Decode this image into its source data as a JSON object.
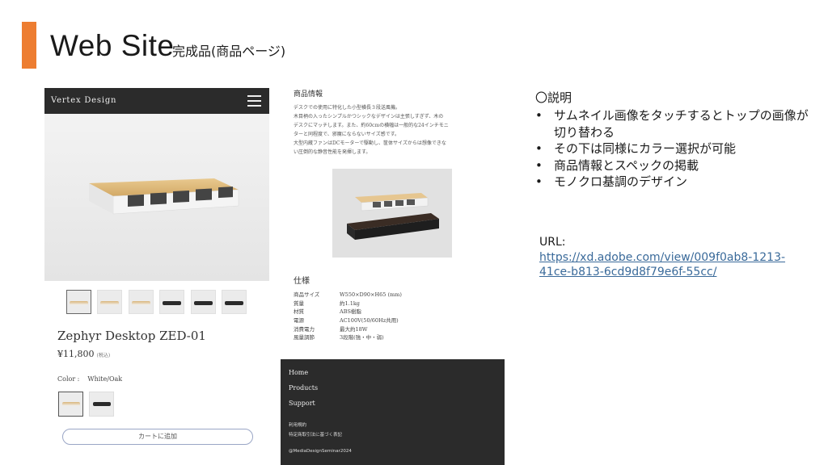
{
  "slide": {
    "title": "Web Site",
    "subtitle": "完成品(商品ページ)",
    "accent_color": "#ED7D31"
  },
  "mobile": {
    "brand": "Vertex Design",
    "menu_icon": "hamburger-menu-icon",
    "product_name": "Zephyr Desktop ZED-01",
    "price": "¥11,800",
    "tax_note": "(税込)",
    "color_label": "Color :",
    "color_value": "White/Oak",
    "cart_button": "カートに追加",
    "thumbnails": [
      {
        "variant": "white-oak",
        "selected": true
      },
      {
        "variant": "white-oak"
      },
      {
        "variant": "white-oak"
      },
      {
        "variant": "black"
      },
      {
        "variant": "black"
      },
      {
        "variant": "black"
      }
    ],
    "swatches": [
      {
        "variant": "white-oak",
        "selected": true
      },
      {
        "variant": "black"
      }
    ]
  },
  "info_page": {
    "heading": "商品情報",
    "description": [
      "デスクでの使用に特化した小型横長３段送風機。",
      "木目柄の入ったシンプルかつシックなデザインは主張しすぎず、木の",
      "デスクにマッチします。また、約60cmの横幅は一般的な24インチモニ",
      "ターと同程度で、邪魔にならないサイズ感です。",
      "大型内蔵ファンはDCモーターで駆動し、筐体サイズからは想像できな",
      "い圧倒的な静音性能を発揮します。"
    ],
    "spec_heading": "仕様",
    "specs": [
      {
        "key": "商品サイズ",
        "value": "W550×D90×H65 (mm)"
      },
      {
        "key": "質量",
        "value": "約1.1kg"
      },
      {
        "key": "材質",
        "value": "ABS樹脂"
      },
      {
        "key": "電源",
        "value": "AC100V(50/60Hz共用)"
      },
      {
        "key": "消費電力",
        "value": "最大約18W"
      },
      {
        "key": "風量調節",
        "value": "3段階(強・中・弱)"
      }
    ],
    "footer": {
      "links": [
        "Home",
        "Products",
        "Support"
      ],
      "legal": [
        "利用規約",
        "特定商取引法に基づく表記"
      ],
      "copyright": "@MediaDesignSeminar2024"
    }
  },
  "explanation": {
    "title": "〇説明",
    "bullets": [
      "サムネイル画像をタッチするとトップの画像が切り替わる",
      "その下は同様にカラー選択が可能",
      "商品情報とスペックの掲載",
      "モノクロ基調のデザイン"
    ],
    "url_label": "URL:",
    "url": "https://xd.adobe.com/view/009f0ab8-1213-41ce-b813-6cd9d8f79e6f-55cc/"
  }
}
